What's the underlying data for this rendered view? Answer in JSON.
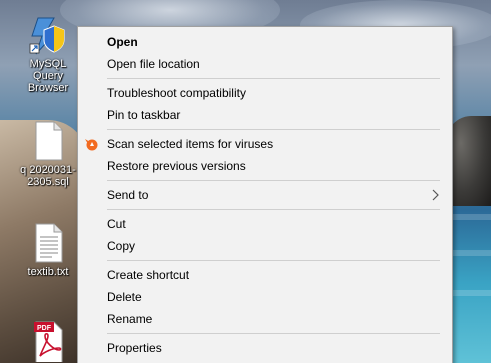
{
  "desktop": {
    "icons": [
      {
        "label": "MySQL\nQuery\nBrowser",
        "type": "app-shortcut"
      },
      {
        "label": "q 2020031-\n2305.sql",
        "type": "file"
      },
      {
        "label": "textib.txt",
        "type": "text-file"
      },
      {
        "label": "",
        "type": "pdf"
      }
    ],
    "pdf_badge": "PDF"
  },
  "context_menu": {
    "items": [
      {
        "label": "Open",
        "bold": true
      },
      {
        "label": "Open file location"
      },
      {
        "label": "Troubleshoot compatibility"
      },
      {
        "label": "Pin to taskbar"
      },
      {
        "label": "Scan selected items for viruses",
        "icon": "avast-icon"
      },
      {
        "label": "Restore previous versions"
      },
      {
        "label": "Send to",
        "submenu": true
      },
      {
        "label": "Cut"
      },
      {
        "label": "Copy"
      },
      {
        "label": "Create shortcut"
      },
      {
        "label": "Delete"
      },
      {
        "label": "Rename"
      },
      {
        "label": "Properties"
      }
    ]
  },
  "colors": {
    "menu_bg": "#f2f2f2",
    "separator": "#cfcfcf",
    "avast_orange": "#f26b21"
  }
}
